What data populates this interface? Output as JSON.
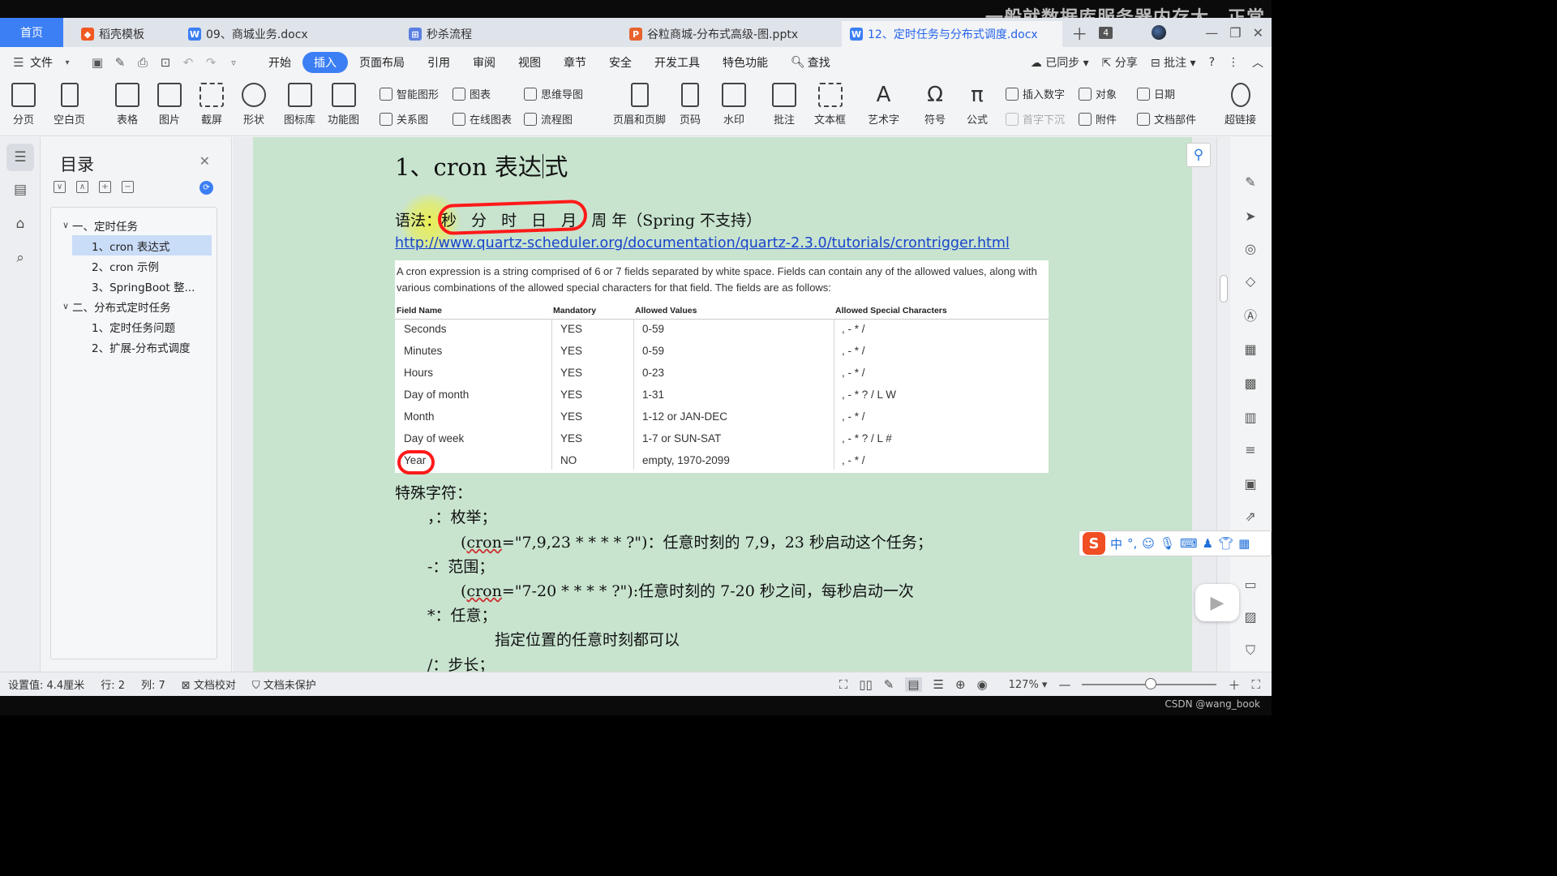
{
  "overlay_caption": "一般就数据库服务器内存大，正常",
  "tabs": [
    {
      "label": "首页",
      "type": "home"
    },
    {
      "label": "稻壳模板",
      "icon_color": "#f05a22"
    },
    {
      "label": "09、商城业务.docx",
      "icon_color": "#3c7ff5"
    },
    {
      "label": "秒杀流程",
      "icon_color": "#5a7fe0"
    },
    {
      "label": "谷粒商城-分布式高级-图.pptx",
      "icon_color": "#e8622c"
    },
    {
      "label": "12、定时任务与分布式调度.docx",
      "icon_color": "#3c7ff5",
      "active": true
    }
  ],
  "tab_count": "4",
  "menu": {
    "file": "文件",
    "items": [
      "开始",
      "插入",
      "页面布局",
      "引用",
      "审阅",
      "视图",
      "章节",
      "安全",
      "开发工具",
      "特色功能"
    ],
    "active": "插入",
    "search": "查找",
    "right": [
      "已同步",
      "分享",
      "批注"
    ]
  },
  "ribbon": {
    "big": [
      "分页",
      "空白页",
      "表格",
      "图片",
      "截屏",
      "形状",
      "图标库",
      "功能图",
      "页眉和页脚",
      "页码",
      "水印",
      "批注",
      "文本框",
      "艺术字",
      "符号",
      "公式",
      "超链接"
    ],
    "small_top": [
      "智能图形",
      "图表",
      "思维导图",
      "插入数字",
      "对象",
      "日期"
    ],
    "small_bottom": [
      "关系图",
      "在线图表",
      "流程图",
      "首字下沉",
      "附件",
      "文档部件"
    ]
  },
  "outline": {
    "title": "目录",
    "items": [
      {
        "label": "一、定时任务",
        "level": 0,
        "expanded": true
      },
      {
        "label": "1、cron 表达式",
        "level": 1,
        "selected": true
      },
      {
        "label": "2、cron 示例",
        "level": 1
      },
      {
        "label": "3、SpringBoot 整...",
        "level": 1
      },
      {
        "label": "二、分布式定时任务",
        "level": 0,
        "expanded": true
      },
      {
        "label": "1、定时任务问题",
        "level": 1
      },
      {
        "label": "2、扩展-分布式调度",
        "level": 1
      }
    ]
  },
  "document": {
    "heading_pre": "1、cron 表达",
    "heading_post": "式",
    "syntax_label": "语法：",
    "syntax_fields": "秒 分 时 日 月 周",
    "syntax_tail": "年（Spring 不支持）",
    "link": "http://www.quartz-scheduler.org/documentation/quartz-2.3.0/tutorials/crontrigger.html",
    "cron_description": "A cron expression is a string comprised of 6 or 7 fields separated by white space. Fields can contain any of the allowed values, along with various combinations of the allowed special characters for that field. The fields are as follows:",
    "cron_headers": [
      "Field Name",
      "Mandatory",
      "Allowed Values",
      "Allowed Special Characters"
    ],
    "cron_rows": [
      [
        "Seconds",
        "YES",
        "0-59",
        ", - * /"
      ],
      [
        "Minutes",
        "YES",
        "0-59",
        ", - * /"
      ],
      [
        "Hours",
        "YES",
        "0-23",
        ", - * /"
      ],
      [
        "Day of month",
        "YES",
        "1-31",
        ", - * ? / L W"
      ],
      [
        "Month",
        "YES",
        "1-12 or JAN-DEC",
        ", - * /"
      ],
      [
        "Day of week",
        "YES",
        "1-7 or SUN-SAT",
        ", - * ? / L #"
      ],
      [
        "Year",
        "NO",
        "empty, 1970-2099",
        ", - * /"
      ]
    ],
    "special_title": "特殊字符：",
    "l1": "，：枚举；",
    "l2_pre": "(",
    "l2_u": "cron",
    "l2_post": "=\"7,9,23 * * * * ?\")：任意时刻的  7,9，23 秒启动这个任务；",
    "l3": "-：范围；",
    "l4_pre": "(",
    "l4_u": "cron",
    "l4_post": "=\"7-20 * * * * ?\"):任意时刻的 7-20 秒之间，每秒启动一次",
    "l5": "*：任意；",
    "l6": "指定位置的任意时刻都可以",
    "l7": "/：步长；"
  },
  "ime": {
    "mode": "中",
    "logo": "S"
  },
  "status": {
    "setting": "设置值: 4.4厘米",
    "row": "行: 2",
    "col": "列: 7",
    "proof": "文档校对",
    "protect": "文档未保护",
    "zoom": "127%",
    "zoom_level": 0.51
  },
  "watermark": "CSDN @wang_book",
  "colors": {
    "accent": "#3c7ff5",
    "page_bg": "#c8e4cf",
    "annotation": "#ff1a1a"
  }
}
